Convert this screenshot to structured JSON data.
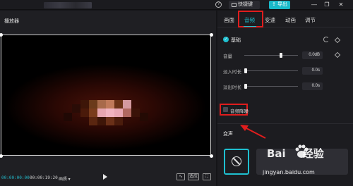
{
  "topbar": {
    "help_icon": "help-circle-icon",
    "shortcut_label": "快捷键",
    "export_label": "导出",
    "window_controls": [
      "minimize-icon",
      "maximize-icon",
      "close-icon"
    ]
  },
  "player": {
    "title": "播放器",
    "current_time": "00:00:00:00",
    "total_time": "00:00:19:20",
    "quality_label": "画质 ▾",
    "ratio_label": "适应",
    "fullscreen_icon": "fullscreen-icon"
  },
  "right_panel": {
    "tabs": [
      {
        "label": "画面",
        "active": false
      },
      {
        "label": "音频",
        "active": true
      },
      {
        "label": "变速",
        "active": false
      },
      {
        "label": "动画",
        "active": false
      },
      {
        "label": "调节",
        "active": false
      }
    ],
    "basic": {
      "label": "基础",
      "checked": true
    },
    "params": [
      {
        "label": "音量",
        "value": "0.0dB",
        "level": 0.78
      },
      {
        "label": "淡入时长",
        "value": "0.0s",
        "level": 0.0
      },
      {
        "label": "淡出时长",
        "value": "0.0s",
        "level": 0.0
      }
    ],
    "noise_reduction": {
      "label": "音频降噪",
      "checked": false
    },
    "voice_change": {
      "label": "变声"
    }
  },
  "watermark": {
    "brand_a": "Bai",
    "brand_b": "经验",
    "url": "jingyan.baidu.com"
  },
  "colors": {
    "accent": "#1fc0d0",
    "highlight_red": "#e01d1d",
    "export_button": "#19b9c9"
  }
}
